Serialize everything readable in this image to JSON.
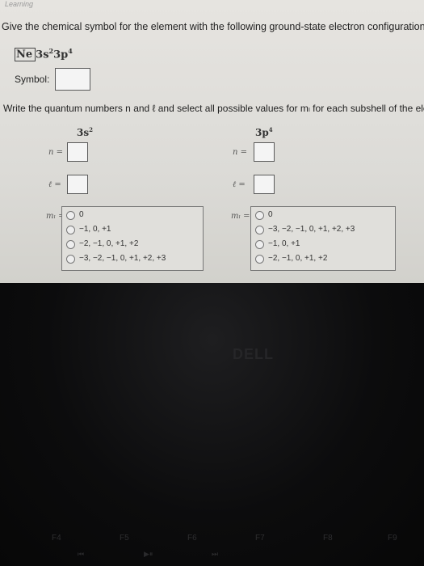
{
  "brand": "Learning",
  "question": "Give the chemical symbol for the element with the following ground-state electron configuration.",
  "config": {
    "core": "Ne",
    "s_part": "3s",
    "s_exp": "2",
    "p_part": "3p",
    "p_exp": "4"
  },
  "symbol_label": "Symbol:",
  "instructions": "Write the quantum numbers n and ℓ and select all possible values for mₗ for each subshell of the elem",
  "subshells": [
    {
      "name": "3s",
      "exp": "2",
      "n_label": "n =",
      "l_label": "ℓ =",
      "m_label": "mₗ =",
      "options": [
        "0",
        "−1, 0, +1",
        "−2, −1, 0, +1, +2",
        "−3, −2, −1, 0, +1, +2, +3"
      ]
    },
    {
      "name": "3p",
      "exp": "4",
      "n_label": "n =",
      "l_label": "ℓ =",
      "m_label": "mₗ =",
      "options": [
        "0",
        "−3, −2, −1, 0, +1, +2, +3",
        "−1, 0, +1",
        "−2, −1, 0, +1, +2"
      ]
    }
  ],
  "laptop": {
    "logo": "DELL",
    "fkeys": [
      "F4",
      "F5",
      "F6",
      "F7",
      "F8",
      "F9"
    ],
    "media": [
      "⏮",
      "▶⏸",
      "⏭"
    ]
  }
}
